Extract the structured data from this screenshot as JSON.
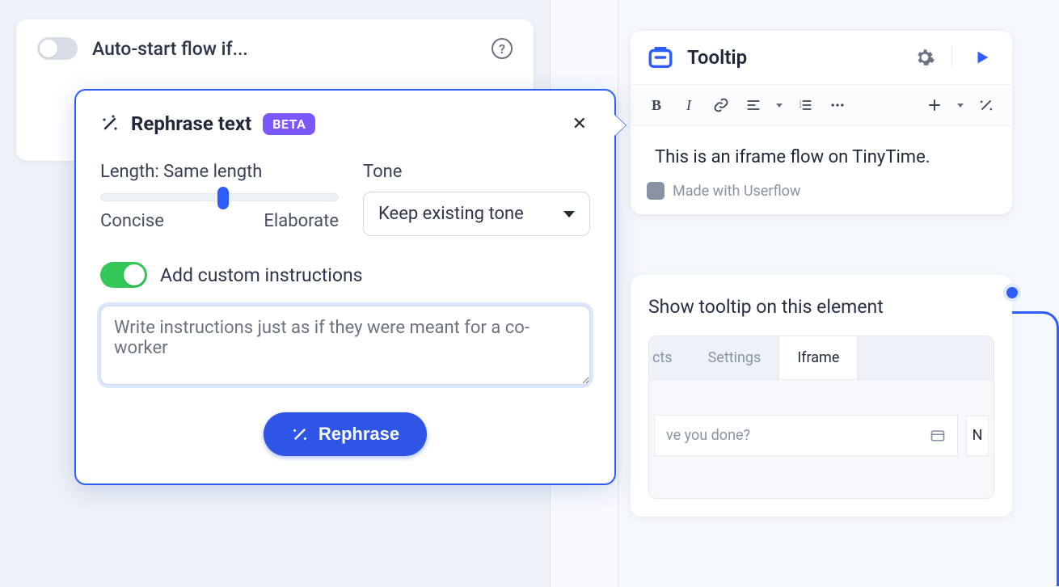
{
  "autostart": {
    "label": "Auto-start flow if..."
  },
  "popover": {
    "title": "Rephrase text",
    "badge": "BETA",
    "length_label": "Length: Same length",
    "length_min": "Concise",
    "length_max": "Elaborate",
    "tone_label": "Tone",
    "tone_value": "Keep existing tone",
    "custom_label": "Add custom instructions",
    "instructions_placeholder": "Write instructions just as if they were meant for a co-worker",
    "rephrase_button": "Rephrase"
  },
  "tooltip": {
    "title": "Tooltip",
    "text": "This is an iframe flow on TinyTime.",
    "footer": "Made with Userflow",
    "format_icons": {
      "bold": "B",
      "italic": "I"
    }
  },
  "element_panel": {
    "heading": "Show tooltip on this element",
    "tab1_cut": "cts",
    "tab2": "Settings",
    "tab3_active": "Iframe",
    "input_cut": "ve you done?",
    "right_cut": "N"
  }
}
